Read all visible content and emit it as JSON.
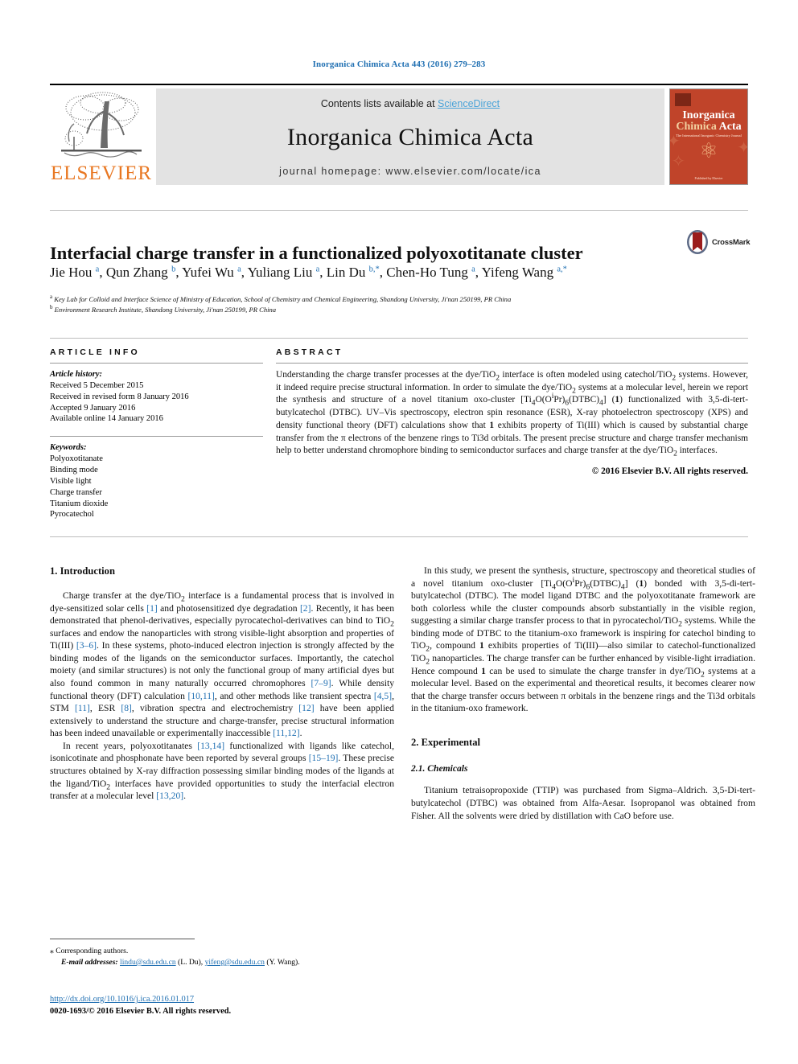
{
  "running_head": "Inorganica Chimica Acta 443 (2016) 279–283",
  "masthead": {
    "publisher_logo_label": "ELSEVIER",
    "contents_prefix": "Contents lists available at ",
    "contents_link": "ScienceDirect",
    "journal_name": "Inorganica Chimica Acta",
    "homepage": "journal homepage: www.elsevier.com/locate/ica",
    "cover": {
      "line1": "Inorganica",
      "line2a": "Chimica",
      "line2b": "Acta",
      "subtitle": "The International Inorganic Chemistry Journal",
      "footer": "Published by Elsevier"
    }
  },
  "article": {
    "title": "Interfacial charge transfer in a functionalized polyoxotitanate cluster",
    "crossmark_label": "CrossMark",
    "authors_html": "Jie Hou <sup>a</sup>, Qun Zhang <sup>b</sup>, Yufei Wu <sup>a</sup>, Yuliang Liu <sup>a</sup>, Lin Du <sup>b,*</sup>, Chen-Ho Tung <sup>a</sup>, Yifeng Wang <sup>a,*</sup>",
    "affiliation_a": "Key Lab for Colloid and Interface Science of Ministry of Education, School of Chemistry and Chemical Engineering, Shandong University, Ji'nan 250199, PR China",
    "affiliation_b": "Environment Research Institute, Shandong University, Ji'nan 250199, PR China"
  },
  "article_info": {
    "heading": "ARTICLE INFO",
    "history_label": "Article history:",
    "history": [
      "Received 5 December 2015",
      "Received in revised form 8 January 2016",
      "Accepted 9 January 2016",
      "Available online 14 January 2016"
    ],
    "keywords_label": "Keywords:",
    "keywords": [
      "Polyoxotitanate",
      "Binding mode",
      "Visible light",
      "Charge transfer",
      "Titanium dioxide",
      "Pyrocatechol"
    ]
  },
  "abstract": {
    "heading": "ABSTRACT",
    "text_html": "Understanding the charge transfer processes at the dye/TiO<sub>2</sub> interface is often modeled using catechol/TiO<sub>2</sub> systems. However, it indeed require precise structural information. In order to simulate the dye/TiO<sub>2</sub> systems at a molecular level, herein we report the synthesis and structure of a novel titanium oxo-cluster [Ti<sub>4</sub>O(O<sup>i</sup>Pr)<sub>6</sub>(DTBC)<sub>4</sub>] (<b>1</b>) functionalized with 3,5-di-tert-butylcatechol (DTBC). UV–Vis spectroscopy, electron spin resonance (ESR), X-ray photoelectron spectroscopy (XPS) and density functional theory (DFT) calculations show that <b>1</b> exhibits property of Ti(III) which is caused by substantial charge transfer from the π electrons of the benzene rings to Ti3d orbitals. The present precise structure and charge transfer mechanism help to better understand chromophore binding to semiconductor surfaces and charge transfer at the dye/TiO<sub>2</sub> interfaces.",
    "copyright": "© 2016 Elsevier B.V. All rights reserved."
  },
  "sections": {
    "intro_heading": "1. Introduction",
    "intro_p1_html": "Charge transfer at the dye/TiO<sub>2</sub> interface is a fundamental process that is involved in dye-sensitized solar cells <span class=\"ref\">[1]</span> and photosensitized dye degradation <span class=\"ref\">[2]</span>. Recently, it has been demonstrated that phenol-derivatives, especially pyrocatechol-derivatives can bind to TiO<sub>2</sub> surfaces and endow the nanoparticles with strong visible-light absorption and properties of Ti(III) <span class=\"ref\">[3–6]</span>. In these systems, photo-induced electron injection is strongly affected by the binding modes of the ligands on the semiconductor surfaces. Importantly, the catechol moiety (and similar structures) is not only the functional group of many artificial dyes but also found common in many naturally occurred chromophores <span class=\"ref\">[7–9]</span>. While density functional theory (DFT) calculation <span class=\"ref\">[10,11]</span>, and other methods like transient spectra <span class=\"ref\">[4,5]</span>, STM <span class=\"ref\">[11]</span>, ESR <span class=\"ref\">[8]</span>, vibration spectra and electrochemistry <span class=\"ref\">[12]</span> have been applied extensively to understand the structure and charge-transfer, precise structural information has been indeed unavailable or experimentally inaccessible <span class=\"ref\">[11,12]</span>.",
    "intro_p2_html": "In recent years, polyoxotitanates <span class=\"ref\">[13,14]</span> functionalized with ligands like catechol, isonicotinate and phosphonate have been reported by several groups <span class=\"ref\">[15–19]</span>. These precise structures obtained by X-ray diffraction possessing similar binding modes of the ligands at the ligand/TiO<sub>2</sub> interfaces have provided opportunities to study the interfacial electron transfer at a molecular level <span class=\"ref\">[13,20]</span>.",
    "intro_p3_html": "In this study, we present the synthesis, structure, spectroscopy and theoretical studies of a novel titanium oxo-cluster [Ti<sub>4</sub>O(O<sup>i</sup>Pr)<sub>6</sub>(DTBC)<sub>4</sub>] (<b>1</b>) bonded with 3,5-di-tert-butylcatechol (DTBC). The model ligand DTBC and the polyoxotitanate framework are both colorless while the cluster compounds absorb substantially in the visible region, suggesting a similar charge transfer process to that in pyrocatechol/TiO<sub>2</sub> systems. While the binding mode of DTBC to the titanium-oxo framework is inspiring for catechol binding to TiO<sub>2</sub>, compound <b>1</b> exhibits properties of Ti(III)—also similar to catechol-functionalized TiO<sub>2</sub> nanoparticles. The charge transfer can be further enhanced by visible-light irradiation. Hence compound <b>1</b> can be used to simulate the charge transfer in dye/TiO<sub>2</sub> systems at a molecular level. Based on the experimental and theoretical results, it becomes clearer now that the charge transfer occurs between π orbitals in the benzene rings and the Ti3d orbitals in the titanium-oxo framework.",
    "exp_heading": "2. Experimental",
    "chem_heading": "2.1. Chemicals",
    "chem_p1_html": "Titanium tetraisopropoxide (TTIP) was purchased from Sigma–Aldrich. 3,5-Di-tert-butylcatechol (DTBC) was obtained from Alfa-Aesar. Isopropanol was obtained from Fisher. All the solvents were dried by distillation with CaO before use."
  },
  "footer": {
    "corresponding_marker": "⁎",
    "corresponding_text": "Corresponding authors.",
    "email_label": "E-mail addresses:",
    "email_1": "lindu@sdu.edu.cn",
    "email_1_owner": "(L. Du),",
    "email_2": "yifeng@sdu.edu.cn",
    "email_2_owner": "(Y. Wang).",
    "doi": "http://dx.doi.org/10.1016/j.ica.2016.01.017",
    "issn_line": "0020-1693/© 2016 Elsevier B.V. All rights reserved."
  },
  "colors": {
    "link_blue": "#1f6fb2",
    "sciencedirect_blue": "#4aa3d8",
    "elsevier_orange": "#e87722",
    "cover_red": "#c0442a",
    "band_gray": "#e3e3e3"
  }
}
